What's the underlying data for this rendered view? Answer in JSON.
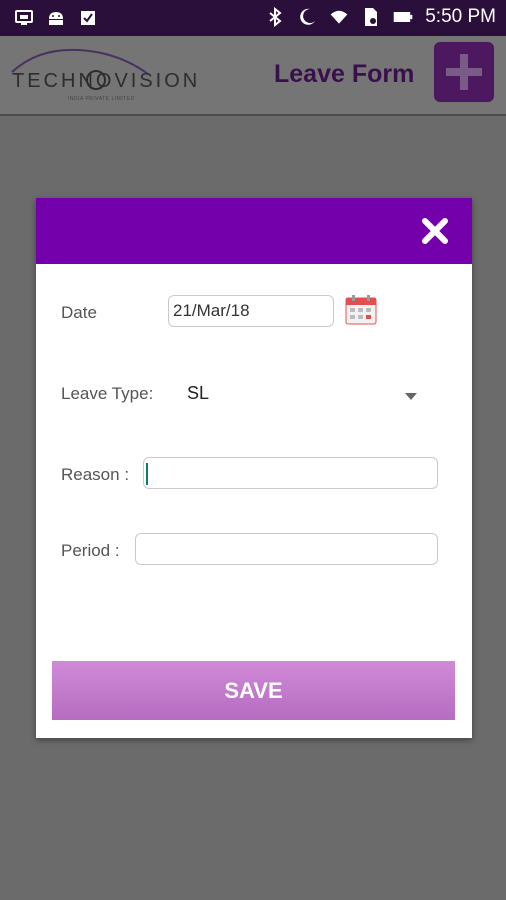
{
  "status_bar": {
    "time": "5:50 PM",
    "icons": [
      "screen-cast-icon",
      "android-icon",
      "checklist-icon",
      "bluetooth-icon",
      "moon-icon",
      "wifi-icon",
      "sim-icon",
      "battery-icon"
    ]
  },
  "header": {
    "logo_text": "TECHNOVISION",
    "logo_subtext": "INDIA PRIVATE LIMITED",
    "title": "Leave Form",
    "add_icon": "plus-icon"
  },
  "dialog": {
    "close_icon": "close-icon",
    "date_label": "Date",
    "date_value": "21/Mar/18",
    "calendar_icon": "calendar-icon",
    "leave_type_label": "Leave Type:",
    "leave_type_value": "SL",
    "reason_label": "Reason :",
    "reason_value": "",
    "period_label": "Period :",
    "period_value": "",
    "save_label": "SAVE"
  },
  "colors": {
    "status_bar": "#2a0f3a",
    "dialog_header": "#7400ac",
    "save_button": "#c47acb",
    "header_title": "#3a0f4d"
  }
}
